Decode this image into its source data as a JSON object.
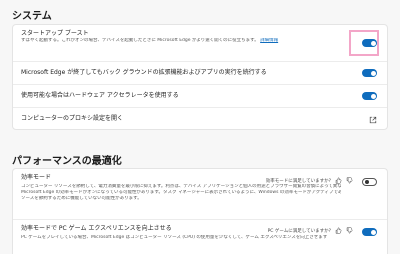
{
  "system": {
    "title": "システム",
    "startup_boost": {
      "title": "スタートアップ ブースト",
      "desc": "すばやく起動する。これがオンの場合、デバイスを起動したときに Microsoft Edge がより速く開くのに役立ちます。",
      "link": "詳細情報",
      "enabled": true
    },
    "background_extensions": {
      "title": "Microsoft Edge が終了してもバック グラウンドの拡張機能およびアプリの実行を続行する",
      "enabled": true
    },
    "hardware_accel": {
      "title": "使用可能な場合はハードウェア アクセラレータを使用する",
      "enabled": true
    },
    "proxy": {
      "title": "コンピューターのプロキシ設定を開く"
    }
  },
  "performance": {
    "title": "パフォーマンスの最適化",
    "efficiency_mode": {
      "title": "効率モード",
      "desc1": "コンピューター リソースを節約して、電力消費量を最小限に抑えます。利点は、デバイス アプリケーションと個人の用途とブラウザー閲覧の習慣によって異なる場合があります。",
      "desc2": "Microsoft Edge の効率モードがオンになっている可能性があります。タスク マネージャーに表示されているように、Windows の効率モードがアクティブであり、デバイスがリ",
      "desc3": "ソースを節約するために機能していない可能性があります。",
      "feedback": "効率モードに満足していますか?",
      "enabled": false
    },
    "pc_game": {
      "title": "効率モードで PC ゲーム エクスペリエンスを向上させる",
      "desc": "PC ゲームをプレイしている場合、Microsoft Edge はコンピューター リソース (CPU) の使用量を少なくして、ゲーム エクスペリエンスを向上させます",
      "feedback": "PC ゲームに満足していますか?",
      "enabled": true
    }
  }
}
